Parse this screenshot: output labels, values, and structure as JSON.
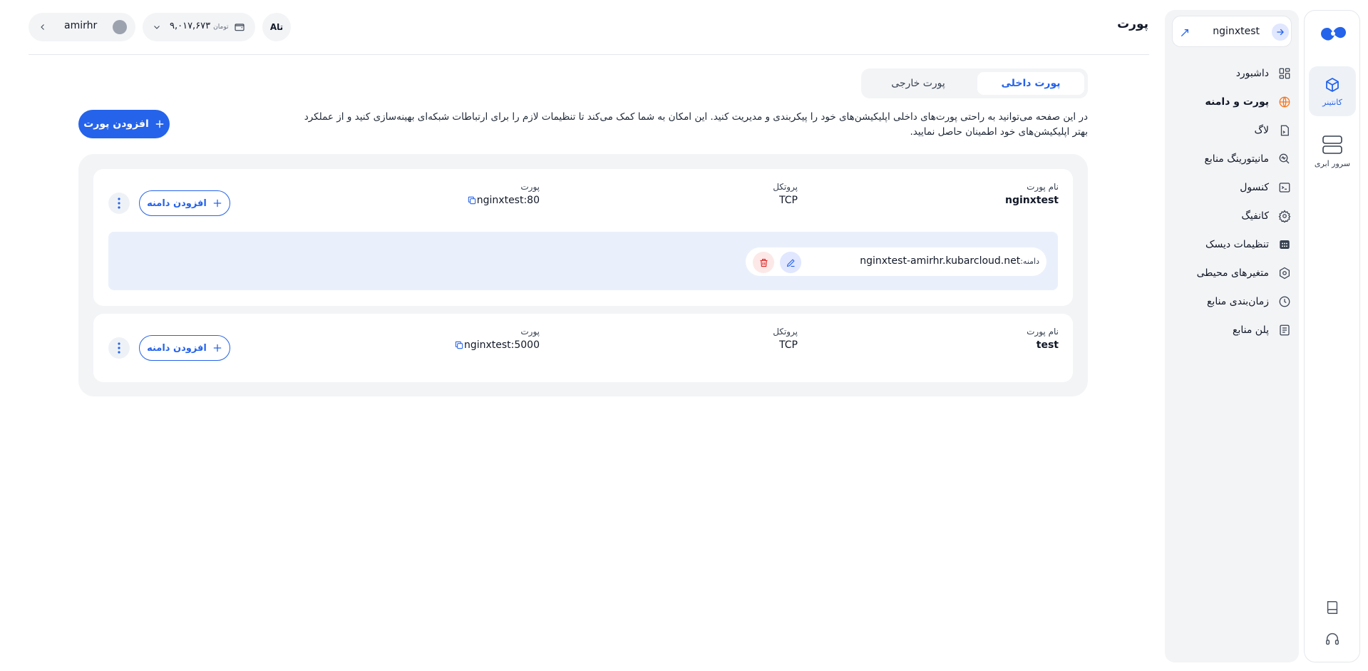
{
  "header": {
    "page_title": "پورت",
    "user": {
      "name": "amirhr"
    },
    "wallet": {
      "amount": "۹,۰۱۷,۶۷۳",
      "unit": "تومان"
    },
    "lang_toggle": "Aتا"
  },
  "rail": {
    "items": [
      {
        "label": "کانتینر",
        "icon": "cube-icon",
        "active": true
      },
      {
        "label": "سرور ابری",
        "icon": "server-icon",
        "active": false
      }
    ]
  },
  "sidebar": {
    "app_name": "nginxtest",
    "items": [
      {
        "label": "داشبورد",
        "icon": "dashboard-icon"
      },
      {
        "label": "پورت و دامنه",
        "icon": "globe-icon",
        "active": true
      },
      {
        "label": "لاگ",
        "icon": "log-file-icon"
      },
      {
        "label": "مانیتورینگ منابع",
        "icon": "monitor-search-icon"
      },
      {
        "label": "کنسول",
        "icon": "terminal-icon"
      },
      {
        "label": "کانفیگ",
        "icon": "gear-icon"
      },
      {
        "label": "تنظیمات دیسک",
        "icon": "disk-icon"
      },
      {
        "label": "متغیرهای محیطی",
        "icon": "hexagon-icon"
      },
      {
        "label": "زمان‌بندی منابع",
        "icon": "clock-icon"
      },
      {
        "label": "پلن منابع",
        "icon": "list-icon"
      }
    ]
  },
  "tabs": [
    {
      "label": "پورت داخلی",
      "active": true
    },
    {
      "label": "پورت خارجی",
      "active": false
    }
  ],
  "description": "در این صفحه می‌توانید به راحتی پورت‌های داخلی اپلیکیشن‌های خود را پیکربندی و مدیریت کنید. این امکان به شما کمک می‌کند تا تنظیمات لازم را برای ارتباطات شبکه‌ای بهینه‌سازی کنید و از عملکرد بهتر اپلیکیشن‌های خود اطمینان حاصل نمایید.",
  "add_port_label": "افزودن پورت",
  "columns": {
    "name": "نام پورت",
    "protocol": "پروتکل",
    "port": "پورت"
  },
  "ports": [
    {
      "name": "nginxtest",
      "protocol": "TCP",
      "port": "nginxtest:80",
      "add_domain_label": "افزودن دامنه",
      "domains": [
        {
          "label": "دامنه:",
          "value": "nginxtest-amirhr.kubarcloud.net"
        }
      ]
    },
    {
      "name": "test",
      "protocol": "TCP",
      "port": "nginxtest:5000",
      "add_domain_label": "افزودن دامنه",
      "domains": []
    }
  ]
}
